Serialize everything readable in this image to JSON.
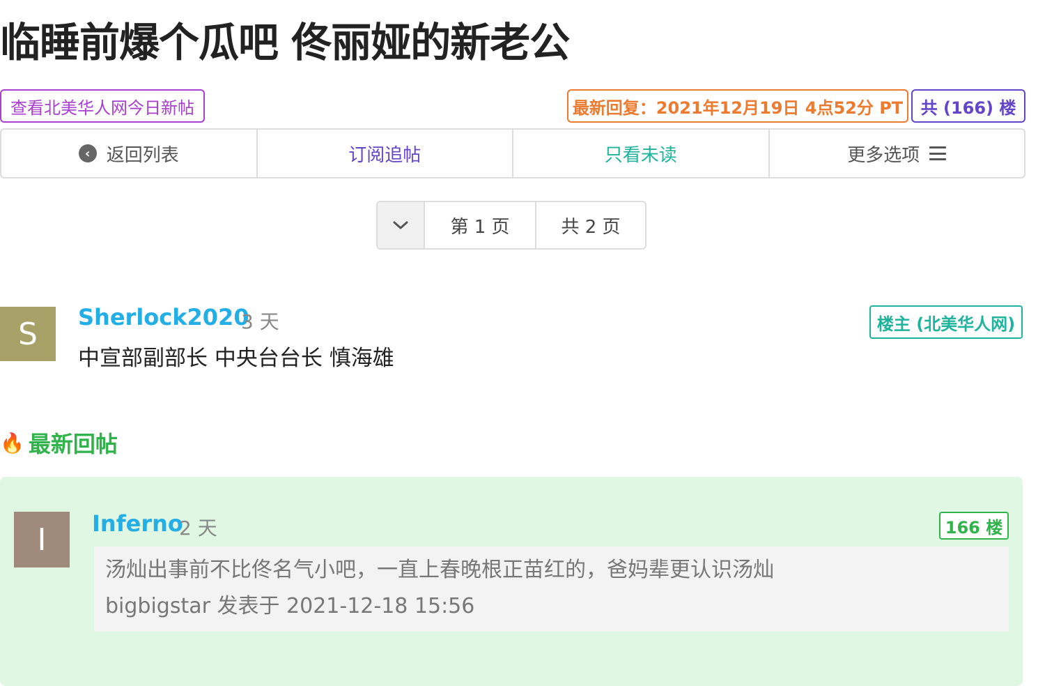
{
  "post": {
    "title": "临睡前爆个瓜吧 佟丽娅的新老公"
  },
  "tags": {
    "today_news": "查看北美华人网今日新帖",
    "latest_reply": "最新回复：2021年12月19日 4点52分 PT",
    "floor_count": "共 (166) 楼"
  },
  "toolbar": {
    "back": "返回列表",
    "subscribe": "订阅追帖",
    "unread_only": "只看未读",
    "more": "更多选项"
  },
  "pager": {
    "current": "第 1 页",
    "total": "共 2 页"
  },
  "op": {
    "avatar_letter": "S",
    "author": "Sherlock2020",
    "time": "3 天",
    "content": "中宣部副部长 中央台台长 慎海雄",
    "badge": "楼主 (北美华人网)"
  },
  "latest_section": {
    "label": "最新回帖"
  },
  "reply": {
    "avatar_letter": "I",
    "author": "Inferno",
    "time": "2 天",
    "floor": "166 楼",
    "quote_text": "汤灿出事前不比佟名气小吧，一直上春晚根正苗红的，爸妈辈更认识汤灿",
    "quote_meta": "bigbigstar 发表于 2021-12-18 15:56"
  },
  "colors": {
    "author_blue": "#23aee6",
    "accent_purple": "#6345c9",
    "accent_teal": "#1fb39d",
    "accent_orange": "#ec7a2f",
    "accent_green": "#2fb34a",
    "reply_bg": "#dff7e3"
  }
}
